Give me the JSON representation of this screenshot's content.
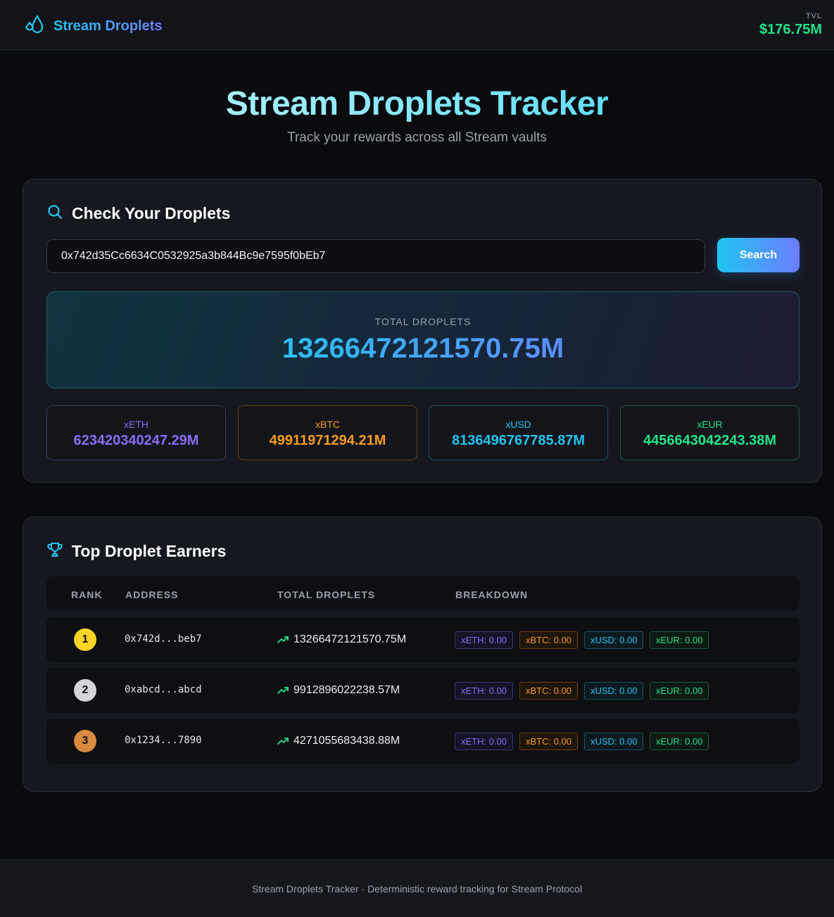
{
  "header": {
    "brand": "Stream Droplets",
    "tvl_label": "TVL",
    "tvl_value": "$176.75M"
  },
  "hero": {
    "title": "Stream Droplets Tracker",
    "subtitle": "Track your rewards across all Stream vaults"
  },
  "check": {
    "title": "Check Your Droplets",
    "input_value": "0x742d35Cc6634C0532925a3b844Bc9e7595f0bEb7",
    "search_label": "Search",
    "total_label": "TOTAL DROPLETS",
    "total_value": "13266472121570.75M",
    "vaults": [
      {
        "name": "xETH",
        "value": "623420340247.29M"
      },
      {
        "name": "xBTC",
        "value": "49911971294.21M"
      },
      {
        "name": "xUSD",
        "value": "8136496767785.87M"
      },
      {
        "name": "xEUR",
        "value": "4456643042243.38M"
      }
    ]
  },
  "leaderboard": {
    "title": "Top Droplet Earners",
    "columns": [
      "RANK",
      "ADDRESS",
      "TOTAL DROPLETS",
      "BREAKDOWN"
    ],
    "rows": [
      {
        "rank": "1",
        "address": "0x742d...beb7",
        "total": "13266472121570.75M",
        "chips": [
          "xETH: 0.00",
          "xBTC: 0.00",
          "xUSD: 0.00",
          "xEUR: 0.00"
        ]
      },
      {
        "rank": "2",
        "address": "0xabcd...abcd",
        "total": "9912896022238.57M",
        "chips": [
          "xETH: 0.00",
          "xBTC: 0.00",
          "xUSD: 0.00",
          "xEUR: 0.00"
        ]
      },
      {
        "rank": "3",
        "address": "0x1234...7890",
        "total": "4271055683438.88M",
        "chips": [
          "xETH: 0.00",
          "xBTC: 0.00",
          "xUSD: 0.00",
          "xEUR: 0.00"
        ]
      }
    ]
  },
  "footer": {
    "text": "Stream Droplets Tracker · Deterministic reward tracking for Stream Protocol"
  },
  "colors": {
    "accent_cyan": "#22c4f1",
    "accent_violet": "#6f7dff",
    "green": "#22e38a",
    "eth": "#8b6cf5",
    "btc": "#f59a23",
    "usd": "#22c3ee",
    "eur": "#22e38a",
    "rank1": "#fcd527",
    "rank2": "#d3d5d9",
    "rank3": "#d98a3e"
  },
  "icons": {
    "brand": "droplets-icon",
    "check": "search-icon",
    "leaderboard": "trophy-icon",
    "row_total": "trending-up-icon"
  }
}
